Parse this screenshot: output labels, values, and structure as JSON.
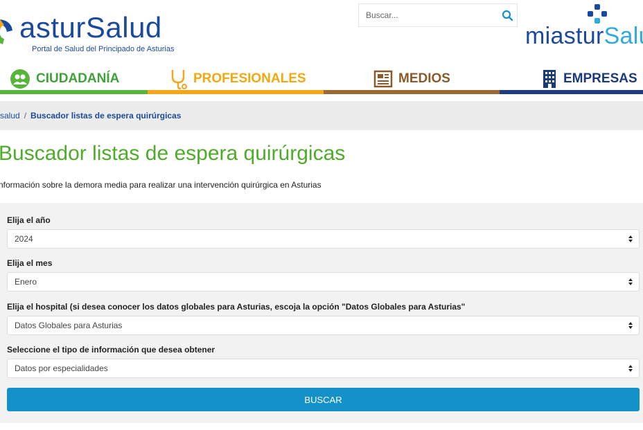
{
  "header": {
    "logo_text": "asturSalud",
    "logo_subtitle": "Portal de Salud del Principado de Asturias",
    "search_placeholder": "Buscar...",
    "mia_prefix": "mi",
    "mia_brand": "astur",
    "mia_suffix": "Salud",
    "search_icon": "search-icon"
  },
  "nav": {
    "items": [
      {
        "label": "CIUDADANÍA",
        "icon": "people-icon",
        "color": "#56b53a"
      },
      {
        "label": "PROFESIONALES",
        "icon": "stethoscope-icon",
        "color": "#f4a51c"
      },
      {
        "label": "MEDIOS",
        "icon": "newspaper-icon",
        "color": "#9a6a35"
      },
      {
        "label": "EMPRESAS",
        "icon": "building-icon",
        "color": "#1d3c7e"
      }
    ]
  },
  "breadcrumb": {
    "home": "salud",
    "separator": "/",
    "current": "Buscador listas de espera quirúrgicas"
  },
  "page": {
    "title": "Buscador listas de espera quirúrgicas",
    "intro": "nformación sobre la demora media para realizar una intervención quirúrgica en Asturias"
  },
  "form": {
    "year_label": "Elija el año",
    "year_value": "2024",
    "month_label": "Elija el mes",
    "month_value": "Enero",
    "hospital_label": "Elija el hospital (si desea conocer los datos globales para Asturias, escoja la opción \"Datos Globales para Asturias\"",
    "hospital_value": "Datos Globales para Asturias",
    "info_label": "Seleccione el tipo de información que desea obtener",
    "info_value": "Datos por especialidades",
    "submit_label": "BUSCAR"
  },
  "colors": {
    "brand_blue": "#1b4a9c",
    "title_green": "#4fab2a",
    "button_blue": "#1591c9"
  }
}
